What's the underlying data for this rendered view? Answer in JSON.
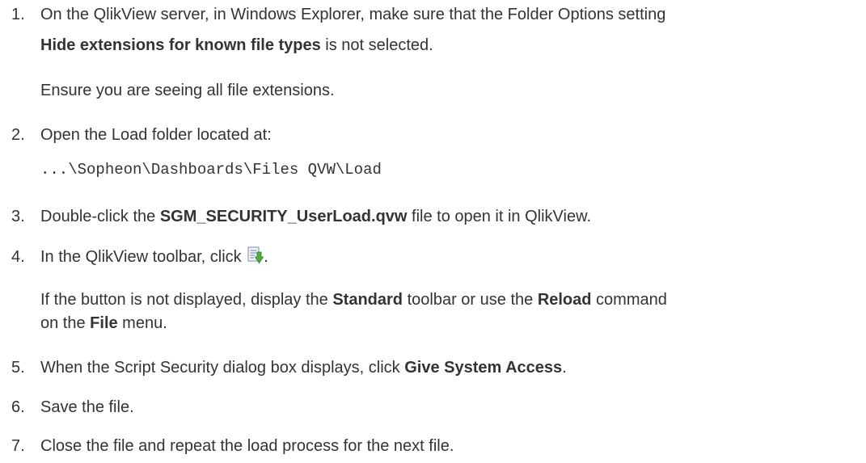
{
  "steps": [
    {
      "number": "1.",
      "line1": "On the QlikView server, in Windows Explorer, make sure that the Folder Options setting",
      "line2_bold": "Hide extensions for known file types",
      "line2_rest": " is not selected.",
      "note": "Ensure you are seeing all file extensions."
    },
    {
      "number": "2.",
      "text": "Open the Load folder located at:",
      "path": "...\\Sopheon\\Dashboards\\Files QVW\\Load"
    },
    {
      "number": "3.",
      "pre": "Double-click the ",
      "bold": "SGM_SECURITY_UserLoad.qvw",
      "post": " file to open it in QlikView."
    },
    {
      "number": "4.",
      "pre": "In the QlikView toolbar, click ",
      "post": ".",
      "icon": "reload-icon",
      "note_a": "If the button is not displayed, display the ",
      "note_b": "Standard",
      "note_c": " toolbar or use the ",
      "note_d": "Reload",
      "note_e": " command",
      "note2_a": "on the ",
      "note2_b": "File",
      "note2_c": " menu."
    },
    {
      "number": "5.",
      "pre": "When the Script Security dialog box displays, click ",
      "bold": "Give System Access",
      "post": "."
    },
    {
      "number": "6.",
      "text": "Save the file."
    },
    {
      "number": "7.",
      "text": "Close the file and repeat the load process for the next file."
    }
  ]
}
